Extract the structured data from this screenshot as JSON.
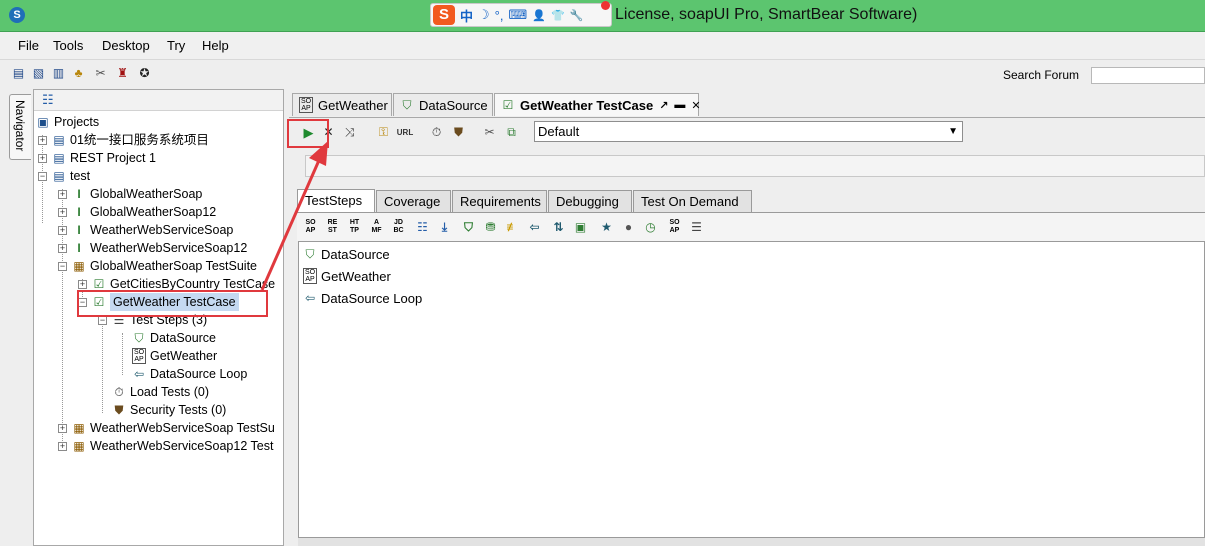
{
  "window": {
    "title": "License, soapUI Pro, SmartBear Software)",
    "ime_logo": "S",
    "ime_mode": "中",
    "ime_items": [
      "☽",
      "°,",
      "⌨",
      "👤",
      "👕",
      "🔧"
    ]
  },
  "menu": [
    "File",
    "Tools",
    "Desktop",
    "Try",
    "Help"
  ],
  "main_toolbar": {
    "search_label": "Search Forum",
    "search_value": ""
  },
  "navigator": {
    "tab_label": "Navigator",
    "tree": [
      {
        "label": "Projects",
        "icon": "projects-icon"
      },
      {
        "label": "01统一接口服务系统项目",
        "icon": "project-icon"
      },
      {
        "label": "REST Project 1",
        "icon": "project-icon"
      },
      {
        "label": "test",
        "icon": "project-icon"
      },
      {
        "label": "GlobalWeatherSoap",
        "icon": "interface-icon"
      },
      {
        "label": "GlobalWeatherSoap12",
        "icon": "interface-icon"
      },
      {
        "label": "WeatherWebServiceSoap",
        "icon": "interface-icon"
      },
      {
        "label": "WeatherWebServiceSoap12",
        "icon": "interface-icon"
      },
      {
        "label": "GlobalWeatherSoap TestSuite",
        "icon": "testsuite-icon"
      },
      {
        "label": "GetCitiesByCountry TestCase",
        "icon": "testcase-icon"
      },
      {
        "label": "GetWeather TestCase",
        "icon": "testcase-icon"
      },
      {
        "label": "Test Steps (3)",
        "icon": "teststeps-icon"
      },
      {
        "label": "DataSource",
        "icon": "datasource-icon"
      },
      {
        "label": "GetWeather",
        "icon": "soap-request-icon"
      },
      {
        "label": "DataSource Loop",
        "icon": "loop-icon"
      },
      {
        "label": "Load Tests (0)",
        "icon": "loadtest-icon"
      },
      {
        "label": "Security Tests (0)",
        "icon": "securitytest-icon"
      },
      {
        "label": "WeatherWebServiceSoap TestSu",
        "icon": "testsuite-icon"
      },
      {
        "label": "WeatherWebServiceSoap12 Test",
        "icon": "testsuite-icon"
      }
    ]
  },
  "editor": {
    "doc_tabs": [
      {
        "label": "GetWeather",
        "icon": "soap-request-icon"
      },
      {
        "label": "DataSource",
        "icon": "datasource-icon"
      },
      {
        "label": "GetWeather TestCase",
        "icon": "testcase-icon"
      }
    ],
    "environment": "Default",
    "url_label": "URL",
    "inner_tabs": [
      "TestSteps",
      "Coverage",
      "Requirements",
      "Debugging",
      "Test On Demand"
    ],
    "step_toolbar_labels": [
      "SO\nAP",
      "RE\nST",
      "HT\nTP",
      "A\nMF",
      "JD\nBC"
    ],
    "steps": [
      {
        "label": "DataSource",
        "icon": "datasource-icon"
      },
      {
        "label": "GetWeather",
        "icon": "soap-request-icon"
      },
      {
        "label": "DataSource Loop",
        "icon": "loop-icon"
      }
    ]
  },
  "colors": {
    "titlebar": "#5cc56f",
    "highlight": "#e0393e",
    "selection": "#c5d9f1"
  }
}
